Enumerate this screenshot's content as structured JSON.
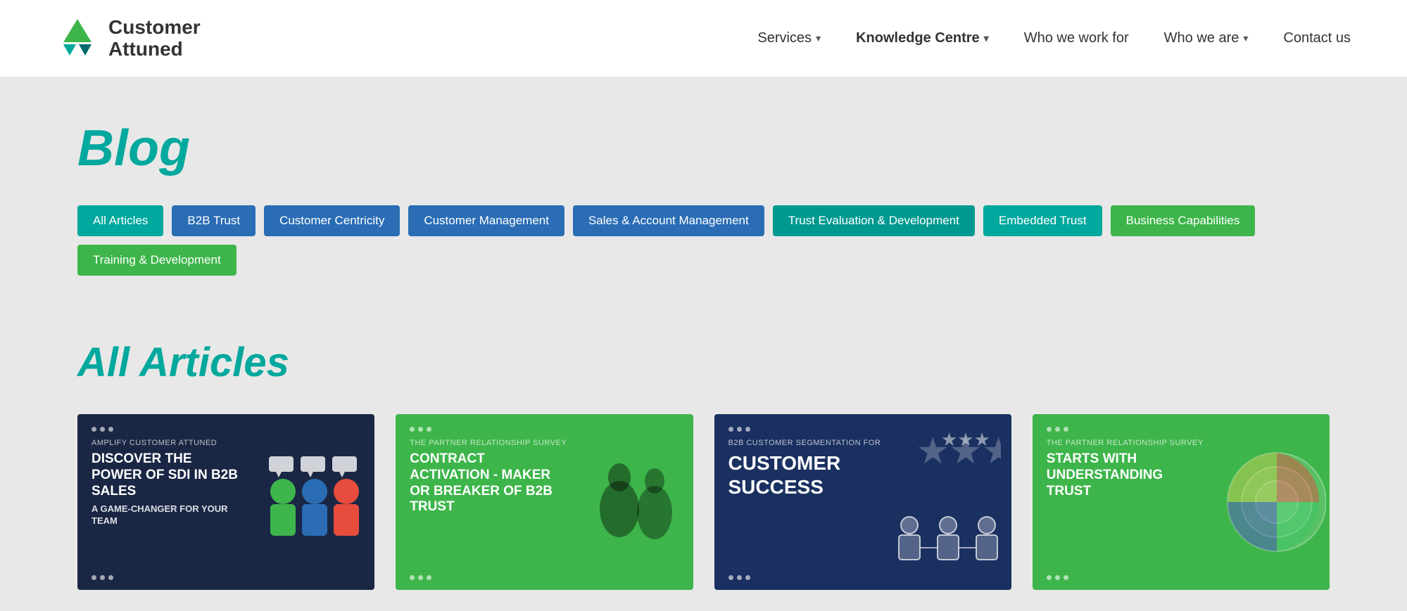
{
  "header": {
    "logo_line1": "Customer",
    "logo_line2": "Attuned",
    "nav": [
      {
        "id": "services",
        "label": "Services",
        "hasDropdown": true,
        "active": false
      },
      {
        "id": "knowledge-centre",
        "label": "Knowledge Centre",
        "hasDropdown": true,
        "active": true
      },
      {
        "id": "who-we-work-for",
        "label": "Who we work for",
        "hasDropdown": false,
        "active": false
      },
      {
        "id": "who-we-are",
        "label": "Who we are",
        "hasDropdown": true,
        "active": false
      },
      {
        "id": "contact-us",
        "label": "Contact us",
        "hasDropdown": false,
        "active": false
      }
    ]
  },
  "blog": {
    "title": "Blog",
    "filters": [
      {
        "id": "all",
        "label": "All Articles",
        "colorClass": "active teal"
      },
      {
        "id": "b2b",
        "label": "B2B Trust",
        "colorClass": "blue"
      },
      {
        "id": "centricity",
        "label": "Customer Centricity",
        "colorClass": "blue"
      },
      {
        "id": "management",
        "label": "Customer Management",
        "colorClass": "blue"
      },
      {
        "id": "sales",
        "label": "Sales & Account Management",
        "colorClass": "blue"
      },
      {
        "id": "trust-eval",
        "label": "Trust Evaluation & Development",
        "colorClass": "teal-mid"
      },
      {
        "id": "embedded",
        "label": "Embedded Trust",
        "colorClass": "teal"
      },
      {
        "id": "business",
        "label": "Business Capabilities",
        "colorClass": "green"
      },
      {
        "id": "training",
        "label": "Training & Development",
        "colorClass": "green"
      }
    ]
  },
  "articles": {
    "title": "All Articles",
    "cards": [
      {
        "id": "card-1",
        "colorClass": "card-1",
        "label": "AMPLIFY  Customer Attuned",
        "title": "DISCOVER THE POWER OF SDI IN B2B SALES",
        "subtitle": "A GAME-CHANGER FOR YOUR TEAM",
        "hasFigures": true,
        "figureType": "people-chat"
      },
      {
        "id": "card-2",
        "colorClass": "card-2",
        "label": "THE PARTNER RELATIONSHIP SURVEY",
        "title": "CONTRACT ACTIVATION - MAKER OR BREAKER OF B2B TRUST",
        "subtitle": "",
        "hasFigures": true,
        "figureType": "silhouettes"
      },
      {
        "id": "card-3",
        "colorClass": "card-3",
        "label": "B2B CUSTOMER SEGMENTATION FOR",
        "title": "CUSTOMER SUCCESS",
        "subtitle": "",
        "hasFigures": true,
        "figureType": "people-blue"
      },
      {
        "id": "card-4",
        "colorClass": "card-4",
        "label": "THE PARTNER RELATIONSHIP SURVEY",
        "title": "STARTS WITH UNDERSTANDING TRUST",
        "subtitle": "",
        "hasFigures": true,
        "figureType": "chart"
      }
    ]
  },
  "colors": {
    "teal": "#00a89d",
    "blue": "#2a6db5",
    "green": "#3db54a",
    "dark_navy": "#1a2744"
  }
}
